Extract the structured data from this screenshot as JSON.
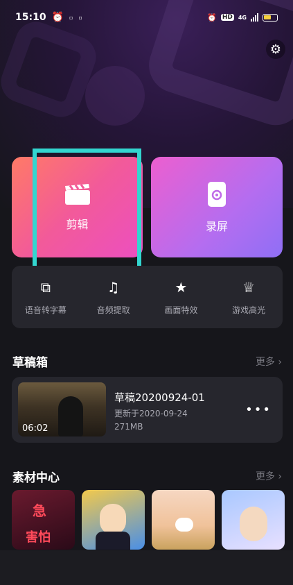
{
  "status_bar": {
    "time": "15:10",
    "network": "4G"
  },
  "main_actions": {
    "edit": {
      "label": "剪辑",
      "icon": "clapperboard-icon"
    },
    "record": {
      "label": "录屏",
      "icon": "screen-record-icon"
    }
  },
  "tools": [
    {
      "label": "语音转字幕",
      "icon": "caption-icon",
      "glyph": "⧉"
    },
    {
      "label": "音频提取",
      "icon": "audio-extract-icon",
      "glyph": "♫"
    },
    {
      "label": "画面特效",
      "icon": "sparkle-effect-icon",
      "glyph": "★"
    },
    {
      "label": "游戏高光",
      "icon": "trophy-icon",
      "glyph": "♕"
    }
  ],
  "drafts": {
    "title": "草稿箱",
    "more": "更多 ›",
    "items": [
      {
        "name": "草稿20200924-01",
        "updated": "更新于2020-09-24",
        "size": "271MB",
        "duration": "06:02"
      }
    ]
  },
  "materials": {
    "title": "素材中心",
    "more": "更多 ›",
    "items": [
      {
        "lines": [
          "急",
          "害怕"
        ]
      },
      {},
      {},
      {}
    ]
  },
  "colors": {
    "highlight": "#33d6d0",
    "edit_card": "#f25a9a",
    "record_card": "#b46df0"
  }
}
